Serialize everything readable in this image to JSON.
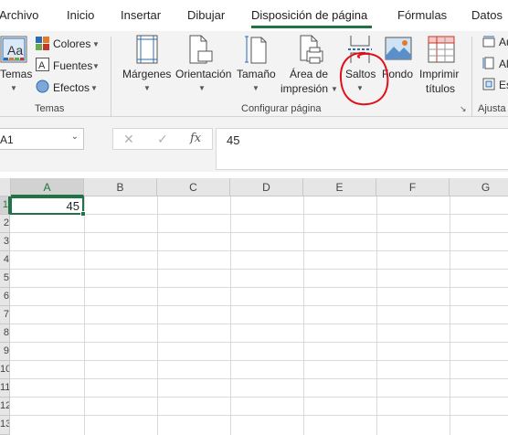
{
  "tabs": [
    {
      "label": "Archivo"
    },
    {
      "label": "Inicio"
    },
    {
      "label": "Insertar"
    },
    {
      "label": "Dibujar"
    },
    {
      "label": "Disposición de página"
    },
    {
      "label": "Fórmulas"
    },
    {
      "label": "Datos"
    }
  ],
  "active_tab": "Disposición de página",
  "ribbon": {
    "temas": {
      "button_label": "Temas",
      "colores": "Colores",
      "fuentes": "Fuentes",
      "efectos": "Efectos",
      "group_label": "Temas"
    },
    "configurar": {
      "margenes": "Márgenes",
      "orientacion": "Orientación",
      "tamano": "Tamaño",
      "area_line1": "Área de",
      "area_line2": "impresión",
      "saltos": "Saltos",
      "fondo": "Fondo",
      "imprimir_line1": "Imprimir",
      "imprimir_line2": "títulos",
      "group_label": "Configurar página"
    },
    "ajustar": {
      "item1": "Au",
      "item2": "Al",
      "item3": "Es",
      "group_label": "Ajusta"
    }
  },
  "formula_bar": {
    "name_box": "A1",
    "cancel": "✕",
    "enter": "✓",
    "fx": "fx",
    "value": "45"
  },
  "grid": {
    "columns": [
      "A",
      "B",
      "C",
      "D",
      "E",
      "F",
      "G"
    ],
    "rows": [
      "1",
      "2",
      "3",
      "4",
      "5",
      "6",
      "7",
      "8",
      "9",
      "10",
      "11",
      "12",
      "13"
    ],
    "cell_a1": "45",
    "selected_cell": "A1"
  },
  "colors": {
    "accent": "#217346",
    "annotation": "#e0101a"
  }
}
